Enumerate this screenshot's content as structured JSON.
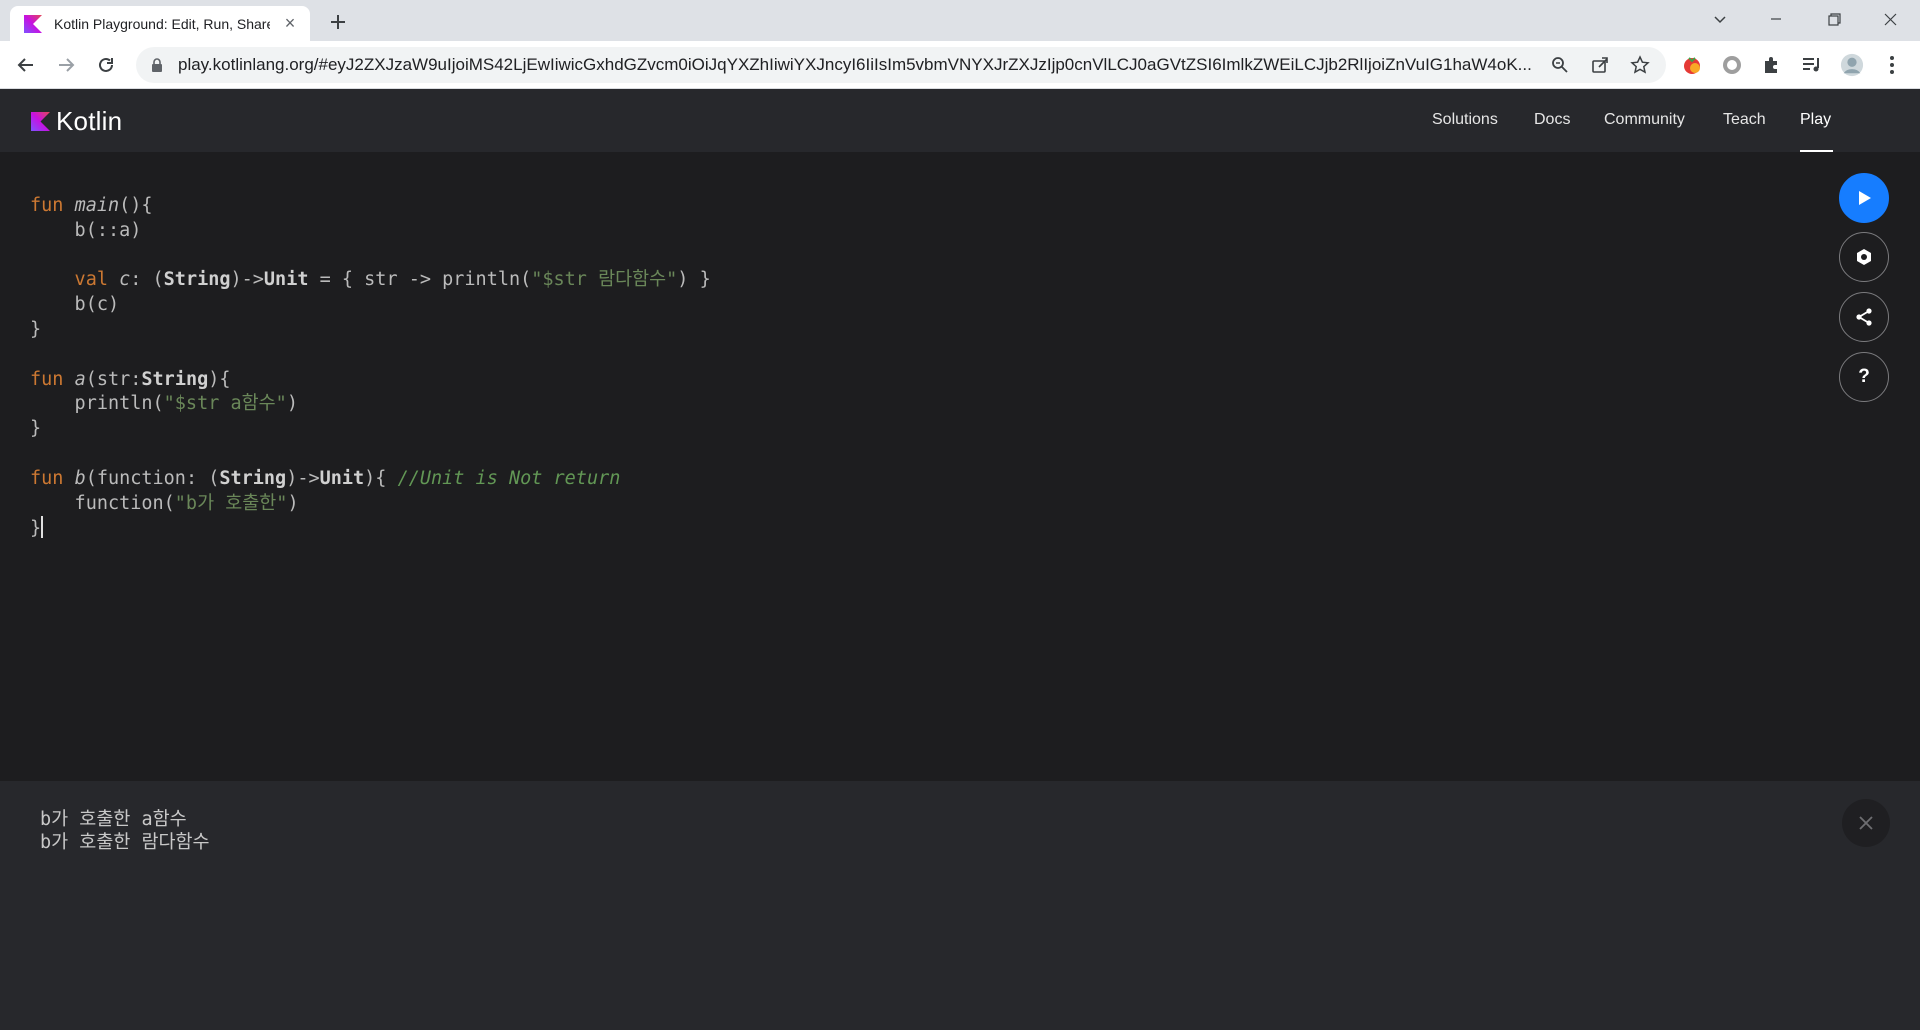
{
  "browser": {
    "tab_title": "Kotlin Playground: Edit, Run, Share Kotlin Code Online",
    "url": "play.kotlinlang.org/#eyJ2ZXJzaW9uIjoiMS42LjEwIiwicGxhdGZvcm0iOiJqYXZhIiwiYXJncyI6IiIsIm5vbmVNYXJrZXJzIjp0cnVlLCJ0aGVtZSI6ImlkZWEiLCJjb2RlIjoiZnVuIG1haW4oK..."
  },
  "header": {
    "logo_text": "Kotlin",
    "nav": [
      "Solutions",
      "Docs",
      "Community",
      "Teach",
      "Play"
    ],
    "active": "Play"
  },
  "editor": {
    "lines": [
      [
        {
          "t": "kw",
          "v": "fun "
        },
        {
          "t": "fn",
          "v": "main"
        },
        {
          "t": "p",
          "v": "(){"
        }
      ],
      [
        {
          "t": "p",
          "v": "    b(::a)"
        }
      ],
      [
        {
          "t": "p",
          "v": ""
        }
      ],
      [
        {
          "t": "kw",
          "v": "    val "
        },
        {
          "t": "fn",
          "v": "c"
        },
        {
          "t": "p",
          "v": ": ("
        },
        {
          "t": "ty",
          "v": "String"
        },
        {
          "t": "p",
          "v": ")->"
        },
        {
          "t": "ty",
          "v": "Unit"
        },
        {
          "t": "p",
          "v": " = { str -> println("
        },
        {
          "t": "str",
          "v": "\"$str 람다함수\""
        },
        {
          "t": "p",
          "v": ") }"
        }
      ],
      [
        {
          "t": "p",
          "v": "    b(c)"
        }
      ],
      [
        {
          "t": "p",
          "v": "}"
        }
      ],
      [
        {
          "t": "p",
          "v": ""
        }
      ],
      [
        {
          "t": "kw",
          "v": "fun "
        },
        {
          "t": "fn",
          "v": "a"
        },
        {
          "t": "p",
          "v": "(str:"
        },
        {
          "t": "ty",
          "v": "String"
        },
        {
          "t": "p",
          "v": "){"
        }
      ],
      [
        {
          "t": "p",
          "v": "    println("
        },
        {
          "t": "str",
          "v": "\"$str a함수\""
        },
        {
          "t": "p",
          "v": ")"
        }
      ],
      [
        {
          "t": "p",
          "v": "}"
        }
      ],
      [
        {
          "t": "p",
          "v": ""
        }
      ],
      [
        {
          "t": "kw",
          "v": "fun "
        },
        {
          "t": "fn",
          "v": "b"
        },
        {
          "t": "p",
          "v": "(function: ("
        },
        {
          "t": "ty",
          "v": "String"
        },
        {
          "t": "p",
          "v": ")->"
        },
        {
          "t": "ty",
          "v": "Unit"
        },
        {
          "t": "p",
          "v": "){ "
        },
        {
          "t": "cm",
          "v": "//Unit is Not return"
        }
      ],
      [
        {
          "t": "p",
          "v": "    function("
        },
        {
          "t": "str",
          "v": "\"b가 호출한\""
        },
        {
          "t": "p",
          "v": ")"
        }
      ],
      [
        {
          "t": "p",
          "v": "}"
        },
        {
          "t": "caret",
          "v": ""
        }
      ]
    ]
  },
  "side_buttons": [
    "run-icon",
    "settings-icon",
    "share-icon",
    "help-icon"
  ],
  "help_label": "?",
  "console": {
    "output": [
      "b가 호출한 a함수",
      "b가 호출한 람다함수"
    ]
  }
}
